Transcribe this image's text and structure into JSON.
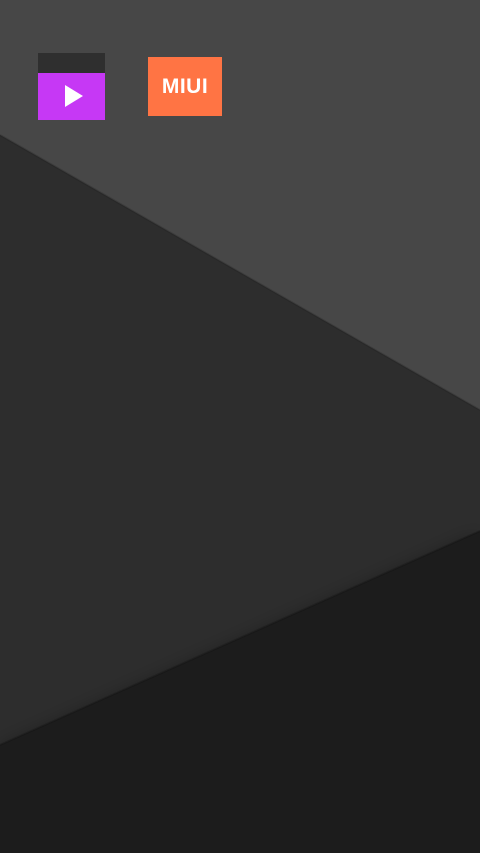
{
  "home_screen": {
    "apps": [
      {
        "name": "video-player",
        "icon": "play-icon",
        "color": "#c638f5"
      },
      {
        "name": "miui",
        "label": "MIUI",
        "color": "#ff7444"
      }
    ]
  },
  "wallpaper": {
    "colors": {
      "top": "#474747",
      "middle": "#2d2d2d",
      "bottom": "#1e1e1e"
    }
  }
}
